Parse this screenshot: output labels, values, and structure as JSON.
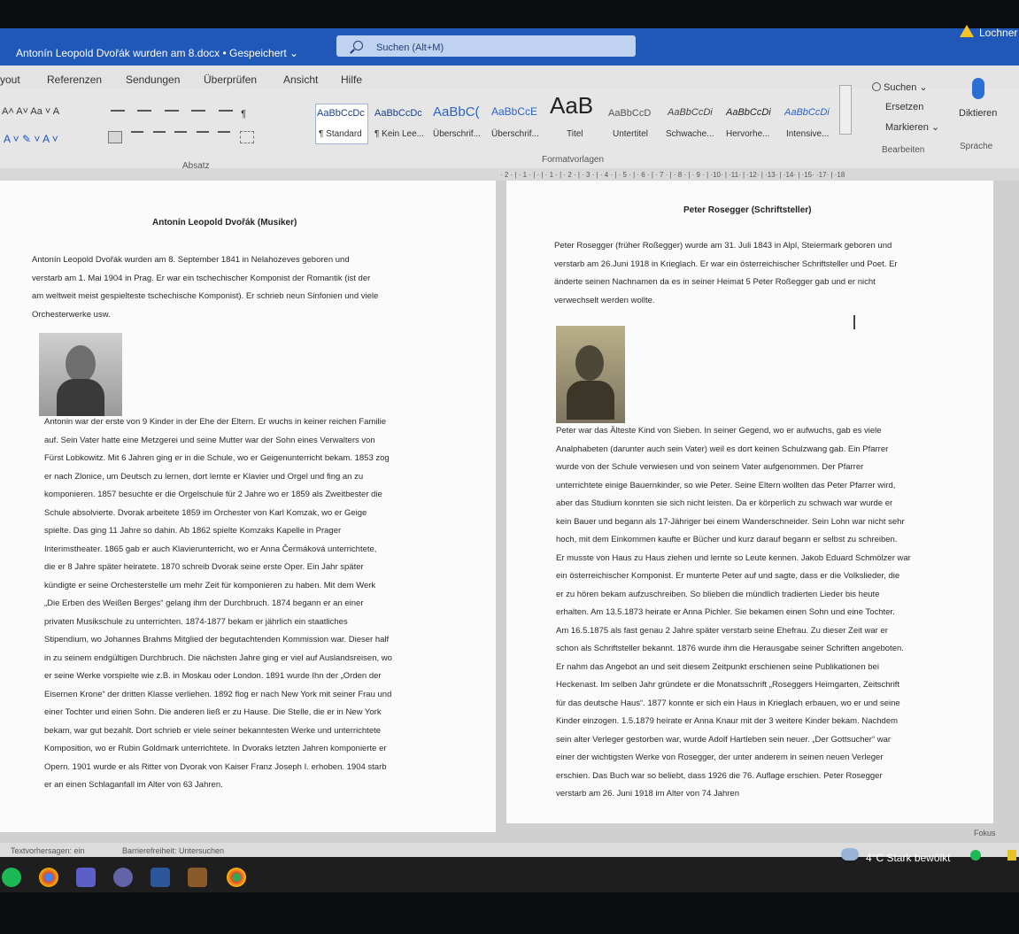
{
  "window": {
    "title": "Antonín Leopold Dvořák wurden am 8.docx • Gespeichert ⌄",
    "search_placeholder": "Suchen (Alt+M)",
    "user": "Lochner"
  },
  "menu": [
    "yout",
    "Referenzen",
    "Sendungen",
    "Überprüfen",
    "Ansicht",
    "Hilfe"
  ],
  "ribbon": {
    "font_row1": "A˄ A˅  Aa ˅  A",
    "font_row2": "A ˅  ✎ ˅  A ˅",
    "group_absatz": "Absatz",
    "group_formatvorlagen": "Formatvorlagen",
    "group_bearbeiten": "Bearbeiten",
    "group_sprache": "Sprache",
    "styles": [
      {
        "preview": "AaBbCcDc",
        "name": "¶ Standard"
      },
      {
        "preview": "AaBbCcDc",
        "name": "¶ Kein Lee..."
      },
      {
        "preview": "AaBbC(",
        "name": "Überschrif..."
      },
      {
        "preview": "AaBbCcE",
        "name": "Überschrif..."
      },
      {
        "preview": "AaB",
        "name": "Titel"
      },
      {
        "preview": "AaBbCcD",
        "name": "Untertitel"
      },
      {
        "preview": "AaBbCcDi",
        "name": "Schwache..."
      },
      {
        "preview": "AaBbCcDi",
        "name": "Hervorhe..."
      },
      {
        "preview": "AaBbCcDi",
        "name": "Intensive..."
      }
    ],
    "suchen": "Suchen ⌄",
    "ersetzen": "Ersetzen",
    "markieren": "Markieren ⌄",
    "diktieren": "Diktieren"
  },
  "ruler": "· 2 · | · 1 · |  · | · 1 · | · 2 · | · 3 · | · 4 · | · 5 · | · 6 · | · 7 · | · 8 · | · 9 · | ·10· | ·11· | ·12· | ·13· | ·14· | ·15·  ·17· | ·18",
  "page1": {
    "heading": "Antonín Leopold Dvořák (Musiker)",
    "intro": [
      "Antonín Leopold Dvořák wurden am 8. September 1841 in Nelahozeves geboren und",
      "verstarb am 1. Mai 1904 in Prag. Er war ein tschechischer Komponist der Romantik (ist der",
      "am weltweit meist gespielteste tschechische Komponist). Er schrieb neun Sinfonien und viele",
      "Orchesterwerke usw."
    ],
    "body": [
      "Antonin war der erste von 9 Kinder in der Ehe der Eltern. Er wuchs in keiner reichen Familie",
      "auf. Sein Vater hatte eine Metzgerei und seine Mutter war der Sohn eines Verwalters von",
      "Fürst Lobkowitz. Mit 6 Jahren ging er in die Schule, wo er Geigenunterricht bekam. 1853 zog",
      "er nach Zlonice, um Deutsch zu lernen, dort lernte er Klavier und Orgel und fing an zu",
      "komponieren. 1857 besuchte er die Orgelschule für 2 Jahre wo er 1859 als Zweitbester die",
      "Schule absolvierte. Dvorak arbeitete 1859 im Orchester von Karl Komzak, wo er Geige",
      "spielte. Das ging 11 Jahre so dahin. Ab 1862 spielte Komzaks Kapelle in Prager",
      "Interimstheater. 1865 gab er auch Klavierunterricht, wo er Anna Čermáková unterrichtete,",
      "die er 8 Jahre später heiratete. 1870 schreib Dvorak seine erste Oper. Ein Jahr später",
      "kündigte er seine Orchesterstelle um mehr Zeit für komponieren zu haben. Mit dem Werk",
      "„Die Erben des Weißen Berges“ gelang ihm der Durchbruch. 1874 begann er an einer",
      "privaten Musikschule zu unterrichten. 1874-1877 bekam er jährlich ein staatliches",
      "Stipendium, wo Johannes Brahms Mitglied der begutachtenden Kommission war. Dieser half",
      "in zu seinem endgültigen Durchbruch. Die nächsten Jahre ging er viel auf Auslandsreisen, wo",
      "er seine Werke vorspielte wie z.B. in Moskau oder London. 1891 wurde Ihn der „Orden der",
      "Eisernen Krone“ der dritten Klasse verliehen. 1892 flog er nach New York mit seiner Frau und",
      "einer Tochter und einen Sohn. Die anderen ließ er zu Hause. Die Stelle, die er in New York",
      "bekam, war gut bezahlt. Dort schrieb er viele seiner bekanntesten Werke und unterrichtete",
      "Komposition, wo er Rubin Goldmark unterrichtete. In Dvoraks letzten Jahren komponierte er",
      "Opern. 1901 wurde er als Ritter von Dvorak von Kaiser Franz Joseph I. erhoben. 1904 starb",
      "er an einen Schlaganfall im Alter von 63 Jahren."
    ]
  },
  "page2": {
    "heading": "Peter Rosegger (Schriftsteller)",
    "intro": [
      "Peter Rosegger (früher Roßegger) wurde am 31. Juli 1843 in Alpl, Steiermark geboren und",
      "verstarb am 26.Juni 1918 in Krieglach. Er war ein österreichischer Schriftsteller und Poet. Er",
      "änderte seinen Nachnamen da es in seiner Heimat 5 Peter Roßegger gab und er nicht",
      "verwechselt werden wollte."
    ],
    "body": [
      "Peter war das Älteste Kind von Sieben. In seiner Gegend, wo er aufwuchs, gab es viele",
      "Analphabeten (darunter auch sein Vater) weil es dort keinen Schulzwang gab. Ein Pfarrer",
      "wurde von der Schule verwiesen und von seinem Vater aufgenommen. Der Pfarrer",
      "unterrichtete einige Bauernkinder, so wie Peter. Seine Eltern wollten das Peter Pfarrer wird,",
      "aber das Studium konnten sie sich nicht leisten. Da er körperlich zu schwach war wurde er",
      "kein Bauer und begann als 17-Jähriger bei einem Wanderschneider. Sein Lohn war nicht sehr",
      "hoch, mit dem Einkommen kaufte er Bücher und kurz darauf begann er selbst zu schreiben.",
      "Er musste von Haus zu Haus ziehen und lernte so Leute kennen. Jakob Eduard Schmölzer war",
      "ein österreichischer Komponist. Er munterte Peter auf und sagte, dass er die Volkslieder, die",
      "er zu hören bekam aufzuschreiben. So blieben die mündlich tradierten Lieder bis heute",
      "erhalten. Am 13.5.1873 heirate er Anna Pichler. Sie bekamen einen Sohn und eine Tochter.",
      "Am 16.5.1875 als fast genau 2 Jahre später verstarb seine Ehefrau. Zu dieser Zeit war er",
      "schon als Schriftsteller bekannt. 1876 wurde ihm die Herausgabe seiner Schriften angeboten.",
      "Er nahm das Angebot an und seit diesem Zeitpunkt erschienen seine Publikationen bei",
      "Heckenast. Im selben Jahr gründete er die Monatsschrift „Roseggers Heimgarten, Zeitschrift",
      "für das deutsche Haus“. 1877 konnte er sich ein Haus in Krieglach erbauen, wo er und seine",
      "Kinder einzogen. 1.5.1879 heirate er Anna Knaur mit der 3 weitere Kinder bekam. Nachdem",
      "sein alter Verleger gestorben war, wurde Adolf Hartleben sein neuer. „Der Gottsucher“ war",
      "einer der wichtigsten Werke von Rosegger, der unter anderem in seinen neuen Verleger",
      "erschien. Das Buch war so beliebt, dass 1926 die 76. Auflage erschien. Peter Rosegger",
      "verstarb am 26. Juni 1918 im Alter von 74 Jahren"
    ]
  },
  "status": {
    "prediction": "Textvorhersagen: ein",
    "accessibility": "Barrierefreiheit: Untersuchen",
    "focus": "Fokus"
  },
  "taskbar": {
    "weather": "4°C  Stark bewölkt"
  }
}
